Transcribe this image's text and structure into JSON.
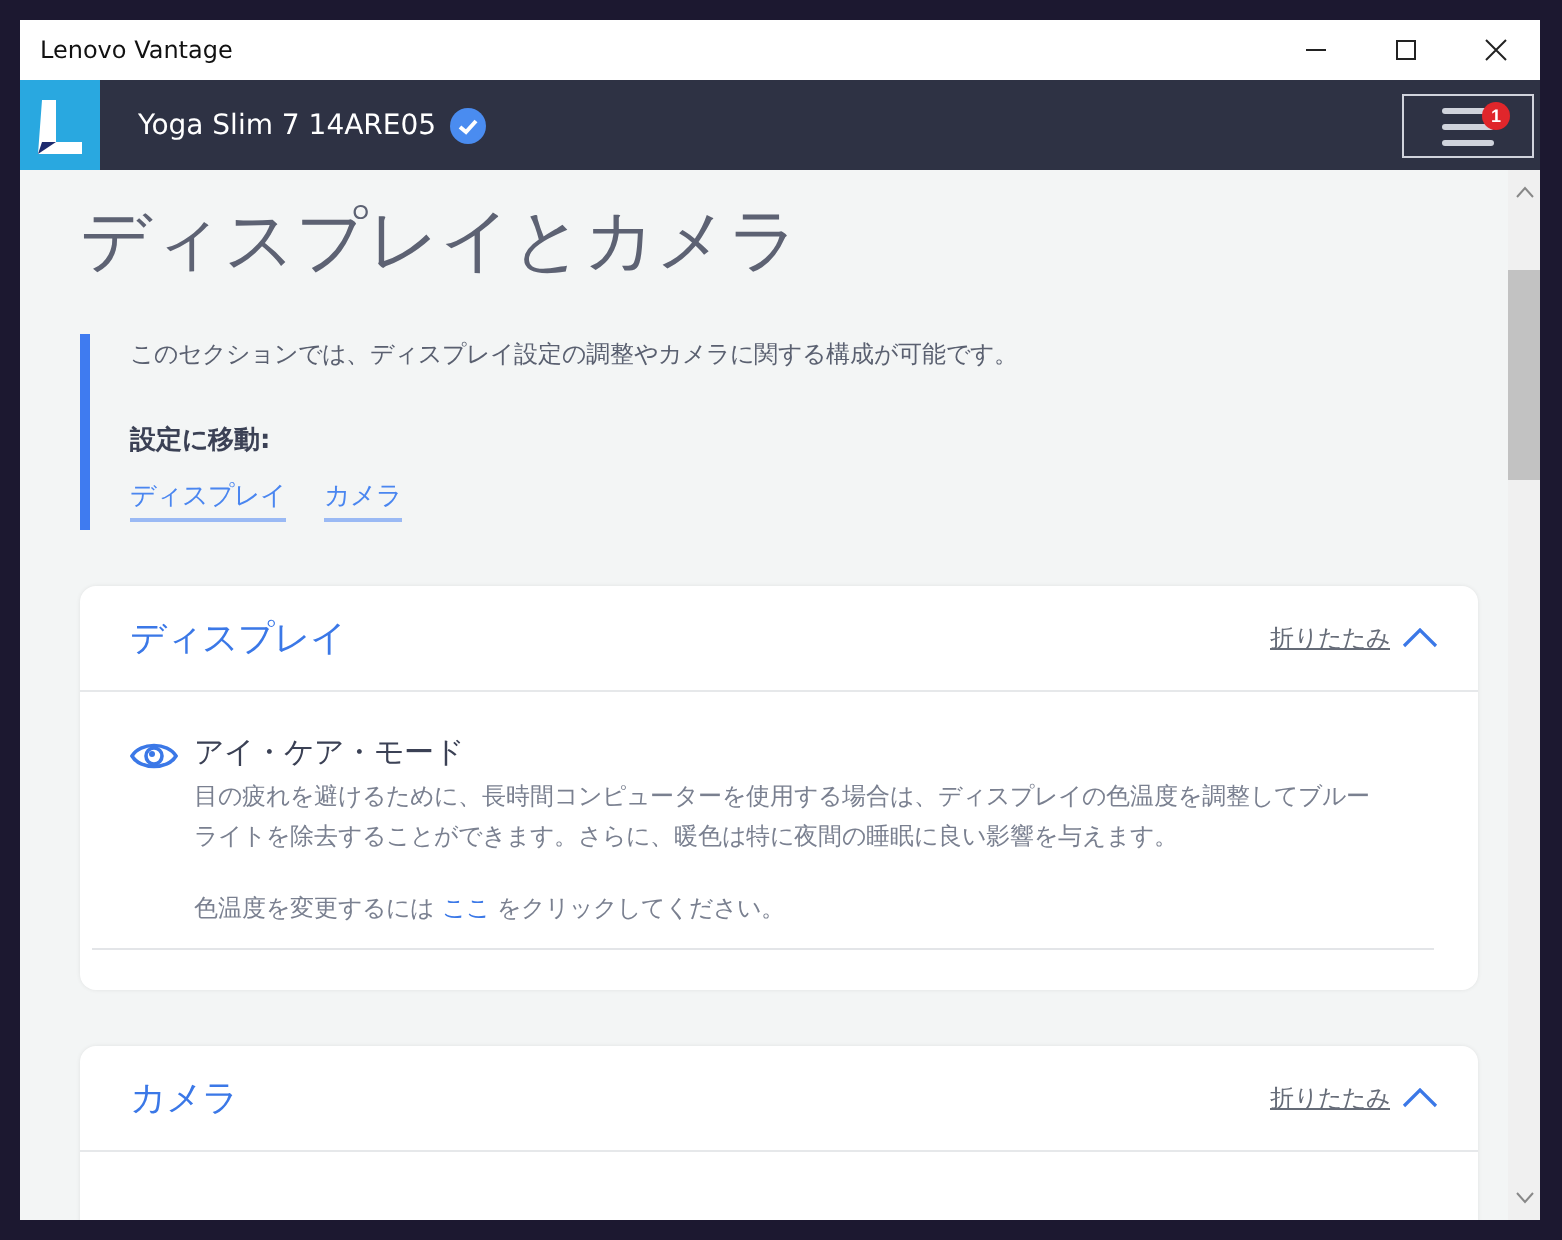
{
  "window": {
    "title": "Lenovo Vantage"
  },
  "app_bar": {
    "device_name": "Yoga Slim 7 14ARE05",
    "verified": true,
    "menu_badge": "1"
  },
  "page": {
    "title": "ディスプレイとカメラ",
    "intro": "このセクションでは、ディスプレイ設定の調整やカメラに関する構成が可能です。",
    "jump_label": "設定に移動:",
    "jump_links": [
      "ディスプレイ",
      "カメラ"
    ]
  },
  "sections": [
    {
      "title": "ディスプレイ",
      "collapse_label": "折りたたみ",
      "expanded": true,
      "items": [
        {
          "title": "アイ・ケア・モード",
          "description": "目の疲れを避けるために、長時間コンピューターを使用する場合は、ディスプレイの色温度を調整してブルーライトを除去することができます。さらに、暖色は特に夜間の睡眠に良い影響を与えます。",
          "action_prefix": "色温度を変更するには",
          "action_link": "ここ",
          "action_suffix": "をクリックしてください。"
        }
      ]
    },
    {
      "title": "カメラ",
      "collapse_label": "折りたたみ",
      "expanded": true
    }
  ]
}
